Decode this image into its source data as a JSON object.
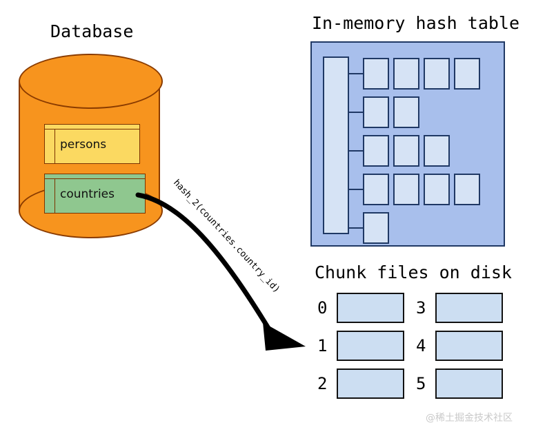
{
  "diagram": {
    "database": {
      "title": "Database",
      "shape": "cylinder",
      "fill_color": "#F7941E",
      "stroke_color": "#8A3B00",
      "tables": [
        {
          "name": "persons",
          "fill_color": "#FBD961"
        },
        {
          "name": "countries",
          "fill_color": "#8FC78F"
        }
      ]
    },
    "arrow": {
      "label": "hash_2(countries.country_id)",
      "color": "#000000",
      "from": "countries",
      "to": "chunk-file-1"
    },
    "hash_table": {
      "title": "In-memory hash table",
      "container_color": "#A8BFEC",
      "cell_color": "#D6E3F5",
      "stroke_color": "#1F3864",
      "bucket_count": 5,
      "chains": [
        {
          "bucket": 0,
          "nodes": 4
        },
        {
          "bucket": 1,
          "nodes": 2
        },
        {
          "bucket": 2,
          "nodes": 3
        },
        {
          "bucket": 3,
          "nodes": 4
        },
        {
          "bucket": 4,
          "nodes": 1
        }
      ]
    },
    "chunk_files": {
      "title": "Chunk files on disk",
      "box_color": "#CCDEF2",
      "stroke_color": "#111111",
      "columns": [
        {
          "labels": [
            "0",
            "1",
            "2"
          ]
        },
        {
          "labels": [
            "3",
            "4",
            "5"
          ]
        }
      ]
    },
    "watermark": "@稀土掘金技术社区"
  }
}
